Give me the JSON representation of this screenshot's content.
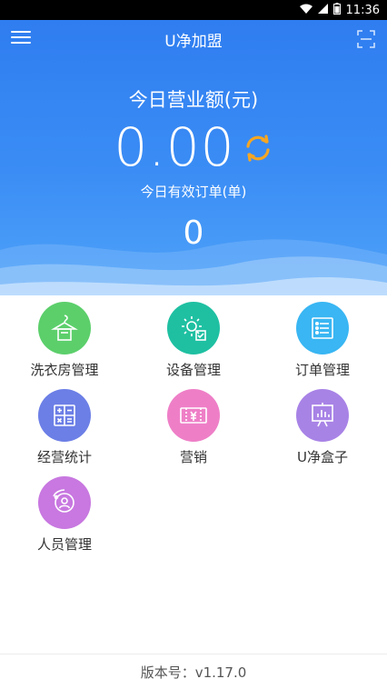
{
  "statusbar": {
    "time": "11:36"
  },
  "header": {
    "title": "U净加盟"
  },
  "summary": {
    "revenue_label": "今日营业额(元)",
    "revenue_value": "0.00",
    "orders_label": "今日有效订单(单)",
    "orders_value": "0"
  },
  "menu": {
    "items": [
      {
        "label": "洗衣房管理",
        "color": "#5ccf6b",
        "icon": "hanger-icon"
      },
      {
        "label": "设备管理",
        "color": "#1fc0a2",
        "icon": "gear-device-icon"
      },
      {
        "label": "订单管理",
        "color": "#39b6f3",
        "icon": "order-list-icon"
      },
      {
        "label": "经营统计",
        "color": "#6c7fe6",
        "icon": "calculator-icon"
      },
      {
        "label": "营销",
        "color": "#ee7fc7",
        "icon": "ticket-icon"
      },
      {
        "label": "U净盒子",
        "color": "#a883e6",
        "icon": "chart-board-icon"
      },
      {
        "label": "人员管理",
        "color": "#c878e0",
        "icon": "person-icon"
      }
    ]
  },
  "footer": {
    "version": "版本号：v1.17.0"
  },
  "colors": {
    "primary": "#2f7df0",
    "refresh": "#f5a623"
  }
}
